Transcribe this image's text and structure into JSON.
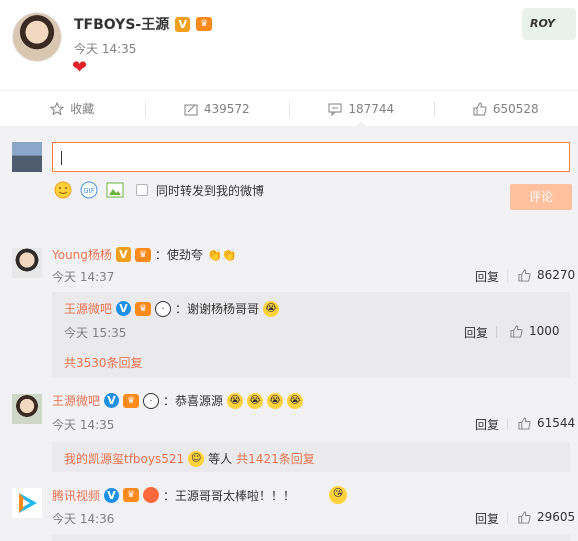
{
  "post": {
    "author": "TFBOYS-王源",
    "verified_badge": "V",
    "member_badge": "会员",
    "time": "今天 14:35",
    "content_emoji": "❤",
    "corner_badge_text": "ROY"
  },
  "actions": [
    {
      "icon": "star-icon",
      "label": "收藏"
    },
    {
      "icon": "repost-icon",
      "label": "439572"
    },
    {
      "icon": "comment-icon",
      "label": "187744"
    },
    {
      "icon": "like-icon",
      "label": "650528"
    }
  ],
  "compose": {
    "forward_label": "同时转发到我的微博",
    "submit_label": "评论",
    "tools": [
      "smile-icon",
      "gif-icon",
      "image-icon"
    ]
  },
  "comments": [
    {
      "user": "Young杨杨",
      "text": "：使劲夸",
      "emojis": "👏👏",
      "time": "今天 14:37",
      "reply": "回复",
      "likes": "86270",
      "sub": {
        "user": "王源微吧",
        "text": "：谢谢杨杨哥哥",
        "time": "今天 15:35",
        "reply": "回复",
        "likes": "1000",
        "more": "共3530条回复"
      }
    },
    {
      "user": "王源微吧",
      "text": "：恭喜源源",
      "time": "今天 14:35",
      "reply": "回复",
      "likes": "61544",
      "sub": {
        "user": "我的凯源玺tfboys521",
        "after_user": "等人",
        "more": "共1421条回复"
      }
    },
    {
      "user": "腾讯视频",
      "text": "：王源哥哥太棒啦！！！",
      "time": "今天 14:36",
      "reply": "回复",
      "likes": "29605"
    }
  ],
  "colors": {
    "accent": "#eb7350",
    "muted": "#808080",
    "comment_bg": "#f2f2f5",
    "input_border": "#fa7d3c",
    "submit_bg": "#ffc09f",
    "heart": "#e0232a"
  }
}
